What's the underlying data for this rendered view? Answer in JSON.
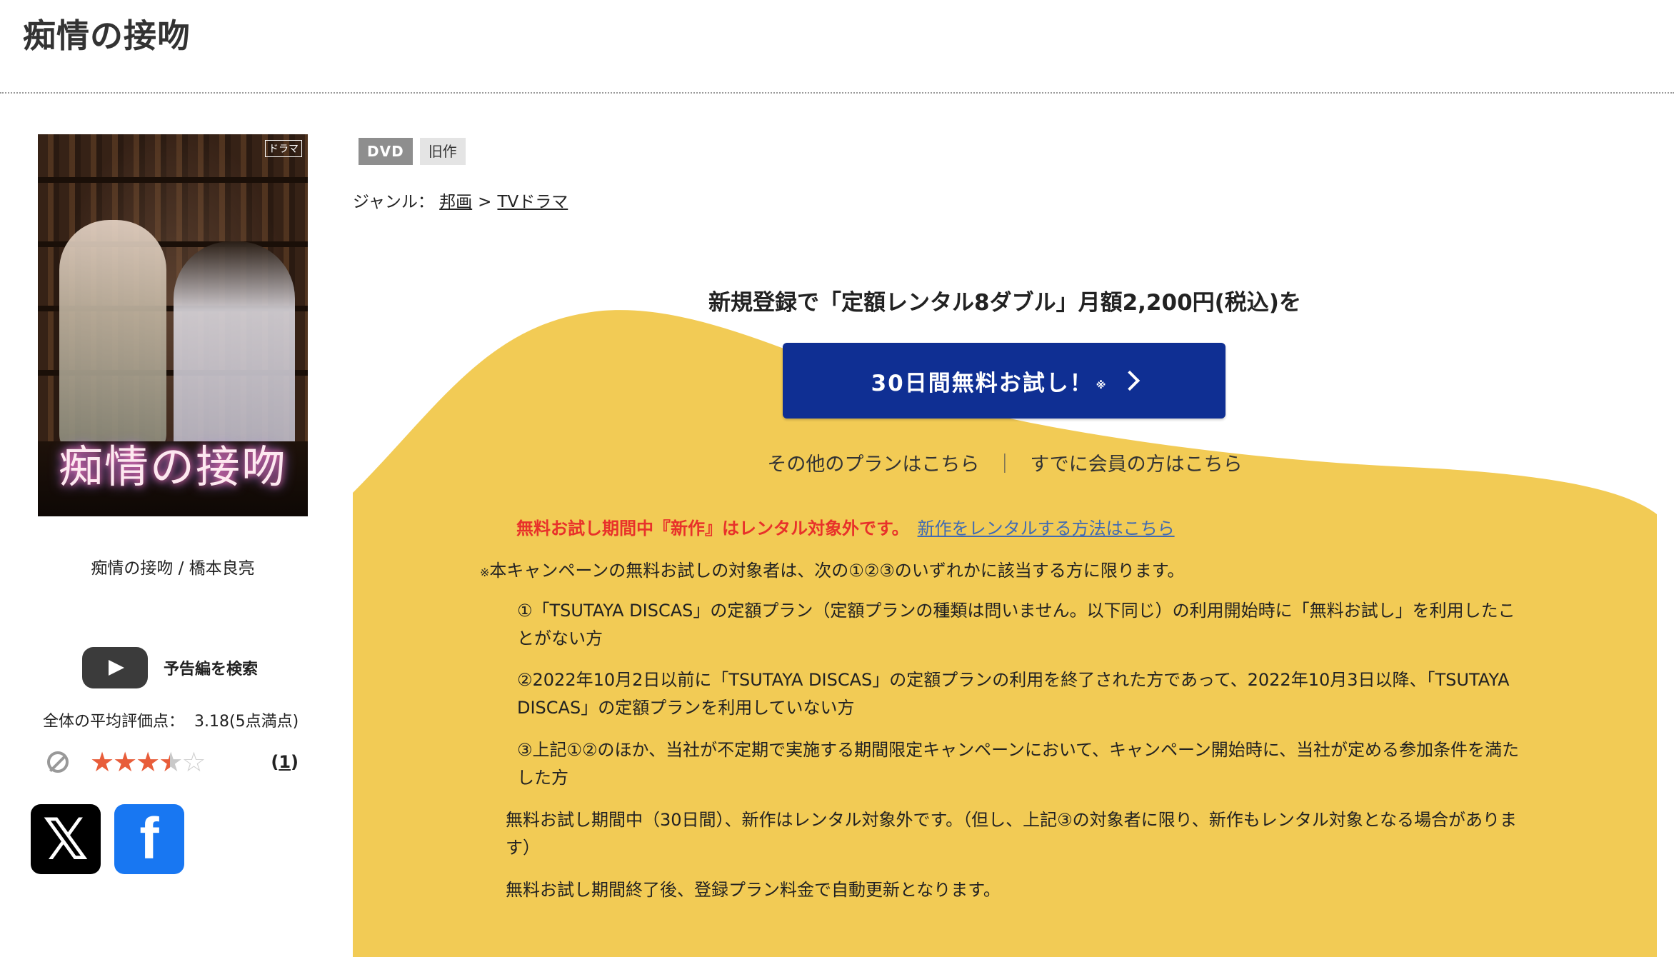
{
  "page": {
    "title": "痴情の接吻"
  },
  "poster": {
    "logo_text": "痴情の接吻",
    "badge": "ドラマ",
    "caption": "痴情の接吻 / 橋本良亮"
  },
  "trailer": {
    "icon": "play-icon",
    "label": "予告編を検索"
  },
  "rating": {
    "average_label": "全体の平均評価点：",
    "average_value": "3.18(5点満点)",
    "stars_value": 3.18,
    "stars_max": 5,
    "review_count": "1",
    "colors": {
      "star_on": "#e85d3a",
      "star_off": "#cfcfcf"
    }
  },
  "social": {
    "x_label": "𝕏",
    "fb_label": "f",
    "x_color": "#000000",
    "fb_color": "#1877f2"
  },
  "tags": [
    "DVD",
    "旧作"
  ],
  "genre": {
    "label": "ジャンル：",
    "items": [
      "邦画",
      "TVドラマ"
    ],
    "separator": ">"
  },
  "campaign": {
    "headline": "新規登録で「定額レンタル8ダブル」月額2,200円(税込)を",
    "cta_label": "30日間無料お試し！",
    "cta_mark": "※",
    "other_plans": "その他のプランはこちら",
    "divider": "｜",
    "members_link": "すでに会員の方はこちら",
    "notice_warning": "無料お試し期間中『新作』はレンタル対象外です。",
    "notice_link": "新作をレンタルする方法はこちら",
    "terms_lead_mark": "※",
    "terms_lead": "本キャンペーンの無料お試しの対象者は、次の①②③のいずれかに該当する方に限ります。",
    "terms": [
      "①「TSUTAYA DISCAS」の定額プラン（定額プランの種類は問いません。以下同じ）の利用開始時に「無料お試し」を利用したことがない方",
      "②2022年10月2日以前に「TSUTAYA DISCAS」の定額プランの利用を終了された方であって、2022年10月3日以降、「TSUTAYA DISCAS」の定額プランを利用していない方",
      "③上記①②のほか、当社が不定期で実施する期間限定キャンペーンにおいて、キャンペーン開始時に、当社が定める参加条件を満たした方"
    ],
    "notes": [
      "無料お試し期間中（30日間）、新作はレンタル対象外です。（但し、上記③の対象者に限り、新作もレンタル対象となる場合があります）",
      "無料お試し期間終了後、登録プラン料金で自動更新となります。"
    ],
    "colors": {
      "background": "#f2cb55",
      "button": "#0f2f93",
      "warning": "#e8312a",
      "link": "#3f6ab4"
    }
  }
}
